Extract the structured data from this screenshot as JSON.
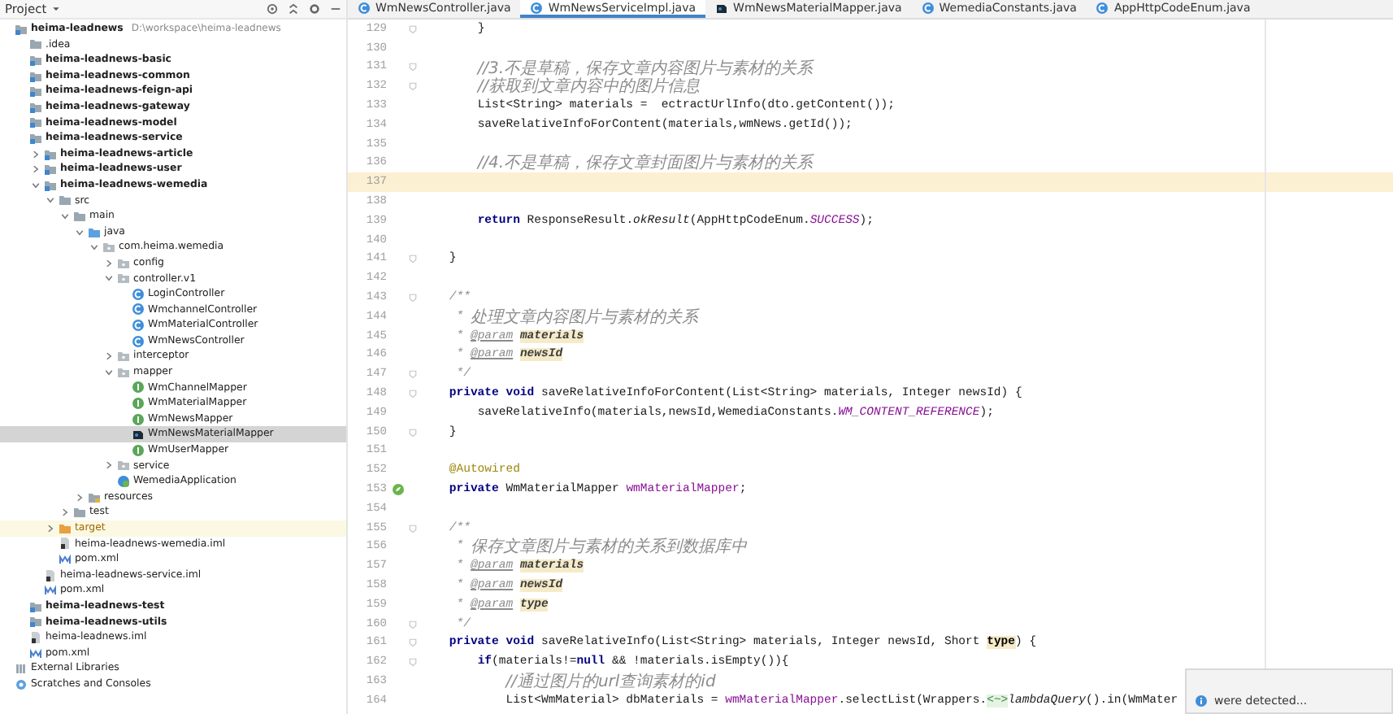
{
  "project": {
    "header": "Project",
    "tree": [
      {
        "label": "heima-leadnews",
        "path": "D:\\workspace\\heima-leadnews",
        "kind": "module",
        "selected": false,
        "children": [
          {
            "label": ".idea",
            "kind": "folder",
            "selected": false
          },
          {
            "label": "heima-leadnews-basic",
            "kind": "module",
            "selected": false
          },
          {
            "label": "heima-leadnews-common",
            "kind": "module",
            "selected": false
          },
          {
            "label": "heima-leadnews-feign-api",
            "kind": "module",
            "selected": false
          },
          {
            "label": "heima-leadnews-gateway",
            "kind": "module",
            "selected": false
          },
          {
            "label": "heima-leadnews-model",
            "kind": "module",
            "selected": false
          },
          {
            "label": "heima-leadnews-service",
            "kind": "module",
            "selected": false,
            "children": [
              {
                "label": "heima-leadnews-article",
                "kind": "module",
                "selected": false,
                "expanded": false
              },
              {
                "label": "heima-leadnews-user",
                "kind": "module",
                "selected": false,
                "expanded": false
              },
              {
                "label": "heima-leadnews-wemedia",
                "kind": "module",
                "selected": false,
                "expanded": true,
                "children": [
                  {
                    "label": "src",
                    "kind": "folder",
                    "selected": false,
                    "expanded": true,
                    "children": [
                      {
                        "label": "main",
                        "kind": "folder",
                        "selected": false,
                        "expanded": true,
                        "children": [
                          {
                            "label": "java",
                            "kind": "source",
                            "selected": false,
                            "expanded": true,
                            "children": [
                              {
                                "label": "com.heima.wemedia",
                                "kind": "package",
                                "selected": false,
                                "expanded": true,
                                "children": [
                                  {
                                    "label": "config",
                                    "kind": "package",
                                    "selected": false,
                                    "expanded": false
                                  },
                                  {
                                    "label": "controller.v1",
                                    "kind": "package",
                                    "selected": false,
                                    "expanded": true,
                                    "children": [
                                      {
                                        "label": "LoginController",
                                        "kind": "class",
                                        "selected": false
                                      },
                                      {
                                        "label": "WmchannelController",
                                        "kind": "class",
                                        "selected": false
                                      },
                                      {
                                        "label": "WmMaterialController",
                                        "kind": "class",
                                        "selected": false
                                      },
                                      {
                                        "label": "WmNewsController",
                                        "kind": "class",
                                        "selected": false
                                      }
                                    ]
                                  },
                                  {
                                    "label": "interceptor",
                                    "kind": "package",
                                    "selected": false,
                                    "expanded": false
                                  },
                                  {
                                    "label": "mapper",
                                    "kind": "package",
                                    "selected": false,
                                    "expanded": true,
                                    "children": [
                                      {
                                        "label": "WmChannelMapper",
                                        "kind": "interface",
                                        "selected": false
                                      },
                                      {
                                        "label": "WmMaterialMapper",
                                        "kind": "interface",
                                        "selected": false
                                      },
                                      {
                                        "label": "WmNewsMapper",
                                        "kind": "interface",
                                        "selected": false
                                      },
                                      {
                                        "label": "WmNewsMaterialMapper",
                                        "kind": "modified",
                                        "selected": true
                                      },
                                      {
                                        "label": "WmUserMapper",
                                        "kind": "interface",
                                        "selected": false
                                      }
                                    ]
                                  },
                                  {
                                    "label": "service",
                                    "kind": "package",
                                    "selected": false,
                                    "expanded": false
                                  },
                                  {
                                    "label": "WemediaApplication",
                                    "kind": "app",
                                    "selected": false
                                  }
                                ]
                              }
                            ]
                          },
                          {
                            "label": "resources",
                            "kind": "resources",
                            "selected": false,
                            "expanded": false
                          }
                        ]
                      },
                      {
                        "label": "test",
                        "kind": "folder",
                        "selected": false,
                        "expanded": false
                      }
                    ]
                  },
                  {
                    "label": "target",
                    "kind": "excluded",
                    "selected": false,
                    "expanded": false
                  },
                  {
                    "label": "heima-leadnews-wemedia.iml",
                    "kind": "iml",
                    "selected": false
                  },
                  {
                    "label": "pom.xml",
                    "kind": "pom",
                    "selected": false
                  }
                ]
              },
              {
                "label": "heima-leadnews-service.iml",
                "kind": "iml",
                "selected": false
              },
              {
                "label": "pom.xml",
                "kind": "pom",
                "selected": false
              }
            ]
          },
          {
            "label": "heima-leadnews-test",
            "kind": "module",
            "selected": false
          },
          {
            "label": "heima-leadnews-utils",
            "kind": "module",
            "selected": false
          },
          {
            "label": "heima-leadnews.iml",
            "kind": "iml",
            "selected": false
          },
          {
            "label": "pom.xml",
            "kind": "pom",
            "selected": false
          }
        ]
      },
      {
        "label": "External Libraries",
        "kind": "library",
        "selected": false
      },
      {
        "label": "Scratches and Consoles",
        "kind": "scratch",
        "selected": false
      }
    ]
  },
  "tabs": [
    {
      "label": "WmNewsController.java",
      "kind": "class",
      "selected": false
    },
    {
      "label": "WmNewsServiceImpl.java",
      "kind": "class",
      "selected": true
    },
    {
      "label": "WmNewsMaterialMapper.java",
      "kind": "modified",
      "selected": false
    },
    {
      "label": "WemediaConstants.java",
      "kind": "class",
      "selected": false
    },
    {
      "label": "AppHttpCodeEnum.java",
      "kind": "class",
      "selected": false
    }
  ],
  "editor": {
    "lines": [
      {
        "number": "129",
        "fold": true,
        "bean": false,
        "current": false,
        "segments": [
          {
            "kind": "plain",
            "text": "        }"
          }
        ]
      },
      {
        "number": "130",
        "fold": false,
        "bean": false,
        "current": false
      },
      {
        "number": "131",
        "fold": true,
        "bean": false,
        "current": false,
        "segments": [
          {
            "kind": "comment",
            "text": "        //3.不是草稿，保存文章内容图片与素材的关系"
          }
        ]
      },
      {
        "number": "132",
        "fold": true,
        "bean": false,
        "current": false,
        "segments": [
          {
            "kind": "comment",
            "text": "        //获取到文章内容中的图片信息"
          }
        ]
      },
      {
        "number": "133",
        "fold": false,
        "bean": false,
        "current": false,
        "segments": [
          {
            "kind": "plain",
            "text": "        List<String> materials =  ectractUrlInfo(dto.getContent());"
          }
        ]
      },
      {
        "number": "134",
        "fold": false,
        "bean": false,
        "current": false,
        "segments": [
          {
            "kind": "plain",
            "text": "        saveRelativeInfoForContent(materials,wmNews.getId());"
          }
        ]
      },
      {
        "number": "135",
        "fold": false,
        "bean": false,
        "current": false
      },
      {
        "number": "136",
        "fold": false,
        "bean": false,
        "current": false,
        "segments": [
          {
            "kind": "comment",
            "text": "        //4.不是草稿，保存文章封面图片与素材的关系"
          }
        ]
      },
      {
        "number": "137",
        "fold": false,
        "bean": false,
        "current": true
      },
      {
        "number": "138",
        "fold": false,
        "bean": false,
        "current": false
      },
      {
        "number": "139",
        "fold": false,
        "bean": false,
        "current": false,
        "segments": [
          {
            "kind": "keyword",
            "text": "        return"
          },
          {
            "kind": "plain",
            "text": " ResponseResult."
          },
          {
            "kind": "static-method",
            "text": "okResult"
          },
          {
            "kind": "plain",
            "text": "(AppHttpCodeEnum."
          },
          {
            "kind": "static-field",
            "text": "SUCCESS"
          },
          {
            "kind": "plain",
            "text": ");"
          }
        ]
      },
      {
        "number": "140",
        "fold": false,
        "bean": false,
        "current": false
      },
      {
        "number": "141",
        "fold": true,
        "bean": false,
        "current": false,
        "segments": [
          {
            "kind": "plain",
            "text": "    }"
          }
        ]
      },
      {
        "number": "142",
        "fold": false,
        "bean": false,
        "current": false
      },
      {
        "number": "143",
        "fold": true,
        "bean": false,
        "current": false,
        "segments": [
          {
            "kind": "doc",
            "text": "    /**"
          }
        ]
      },
      {
        "number": "144",
        "fold": false,
        "bean": false,
        "current": false,
        "segments": [
          {
            "kind": "doc",
            "text": "     * "
          },
          {
            "kind": "comment",
            "text": "处理文章内容图片与素材的关系"
          }
        ]
      },
      {
        "number": "145",
        "fold": false,
        "bean": false,
        "current": false,
        "segments": [
          {
            "kind": "doc",
            "text": "     * "
          },
          {
            "kind": "doc-tag",
            "text": "@param"
          },
          {
            "kind": "param",
            "text": " materials"
          }
        ]
      },
      {
        "number": "146",
        "fold": false,
        "bean": false,
        "current": false,
        "segments": [
          {
            "kind": "doc",
            "text": "     * "
          },
          {
            "kind": "doc-tag",
            "text": "@param"
          },
          {
            "kind": "param",
            "text": " newsId"
          }
        ]
      },
      {
        "number": "147",
        "fold": true,
        "bean": false,
        "current": false,
        "segments": [
          {
            "kind": "doc",
            "text": "     */"
          }
        ]
      },
      {
        "number": "148",
        "fold": true,
        "bean": false,
        "current": false,
        "segments": [
          {
            "kind": "keyword",
            "text": "    private void"
          },
          {
            "kind": "plain",
            "text": " saveRelativeInfoForContent(List<String> materials, Integer newsId) {"
          }
        ]
      },
      {
        "number": "149",
        "fold": false,
        "bean": false,
        "current": false,
        "segments": [
          {
            "kind": "plain",
            "text": "        saveRelativeInfo(materials,newsId,WemediaConstants."
          },
          {
            "kind": "static-field",
            "text": "WM_CONTENT_REFERENCE"
          },
          {
            "kind": "plain",
            "text": ");"
          }
        ]
      },
      {
        "number": "150",
        "fold": true,
        "bean": false,
        "current": false,
        "segments": [
          {
            "kind": "plain",
            "text": "    }"
          }
        ]
      },
      {
        "number": "151",
        "fold": false,
        "bean": false,
        "current": false
      },
      {
        "number": "152",
        "fold": false,
        "bean": false,
        "current": false,
        "segments": [
          {
            "kind": "annotation",
            "text": "    @Autowired"
          }
        ]
      },
      {
        "number": "153",
        "fold": false,
        "bean": true,
        "current": false,
        "segments": [
          {
            "kind": "keyword",
            "text": "    private"
          },
          {
            "kind": "plain",
            "text": " WmMaterialMapper "
          },
          {
            "kind": "field",
            "text": "wmMaterialMapper"
          },
          {
            "kind": "plain",
            "text": ";"
          }
        ]
      },
      {
        "number": "154",
        "fold": false,
        "bean": false,
        "current": false
      },
      {
        "number": "155",
        "fold": true,
        "bean": false,
        "current": false,
        "segments": [
          {
            "kind": "doc",
            "text": "    /**"
          }
        ]
      },
      {
        "number": "156",
        "fold": false,
        "bean": false,
        "current": false,
        "segments": [
          {
            "kind": "doc",
            "text": "     * "
          },
          {
            "kind": "comment",
            "text": "保存文章图片与素材的关系到数据库中"
          }
        ]
      },
      {
        "number": "157",
        "fold": false,
        "bean": false,
        "current": false,
        "segments": [
          {
            "kind": "doc",
            "text": "     * "
          },
          {
            "kind": "doc-tag",
            "text": "@param"
          },
          {
            "kind": "param",
            "text": " materials"
          }
        ]
      },
      {
        "number": "158",
        "fold": false,
        "bean": false,
        "current": false,
        "segments": [
          {
            "kind": "doc",
            "text": "     * "
          },
          {
            "kind": "doc-tag",
            "text": "@param"
          },
          {
            "kind": "param",
            "text": " newsId"
          }
        ]
      },
      {
        "number": "159",
        "fold": false,
        "bean": false,
        "current": false,
        "segments": [
          {
            "kind": "doc",
            "text": "     * "
          },
          {
            "kind": "doc-tag",
            "text": "@param"
          },
          {
            "kind": "param",
            "text": " type"
          }
        ]
      },
      {
        "number": "160",
        "fold": true,
        "bean": false,
        "current": false,
        "segments": [
          {
            "kind": "doc",
            "text": "     */"
          }
        ]
      },
      {
        "number": "161",
        "fold": true,
        "bean": false,
        "current": false,
        "segments": [
          {
            "kind": "keyword",
            "text": "    private void"
          },
          {
            "kind": "plain",
            "text": " saveRelativeInfo(List<String> materials, Integer newsId, Short "
          },
          {
            "kind": "usage",
            "text": "type"
          },
          {
            "kind": "plain",
            "text": ") {"
          }
        ]
      },
      {
        "number": "162",
        "fold": true,
        "bean": false,
        "current": false,
        "segments": [
          {
            "kind": "keyword",
            "text": "        if"
          },
          {
            "kind": "plain",
            "text": "(materials!="
          },
          {
            "kind": "keyword",
            "text": "null"
          },
          {
            "kind": "plain",
            "text": " && !materials.isEmpty()){"
          }
        ]
      },
      {
        "number": "163",
        "fold": false,
        "bean": false,
        "current": false,
        "segments": [
          {
            "kind": "comment",
            "text": "            //通过图片的url查询素材的id"
          }
        ]
      },
      {
        "number": "164",
        "fold": false,
        "bean": false,
        "current": false,
        "segments": [
          {
            "kind": "plain",
            "text": "            List<WmMaterial> dbMaterials = "
          },
          {
            "kind": "field",
            "text": "wmMaterialMapper"
          },
          {
            "kind": "plain",
            "text": ".selectList(Wrappers."
          },
          {
            "kind": "hint",
            "text": "<~>"
          },
          {
            "kind": "static-method",
            "text": "lambdaQuery"
          },
          {
            "kind": "plain",
            "text": "().in(WmMater"
          }
        ]
      }
    ]
  },
  "notification": {
    "text": "were detected..."
  }
}
